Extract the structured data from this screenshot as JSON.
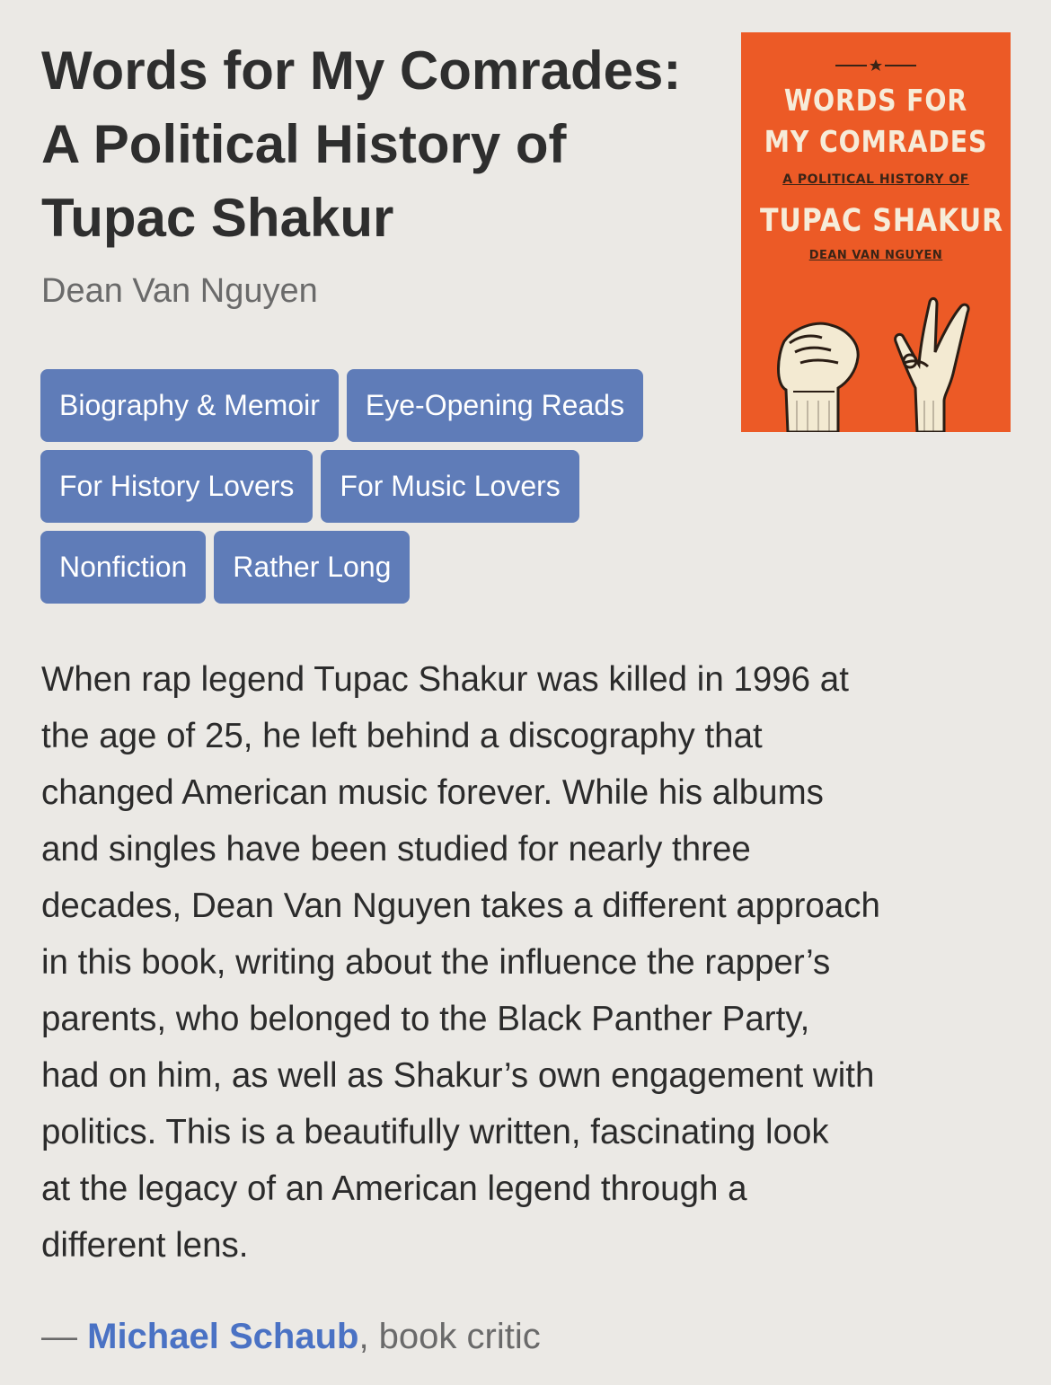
{
  "book": {
    "title_lines": [
      "Words for My Comrades:",
      "A Political History of",
      "Tupac Shakur"
    ],
    "author": "Dean Van Nguyen"
  },
  "tags": [
    "Biography & Memoir",
    "Eye-Opening Reads",
    "For History Lovers",
    "For Music Lovers",
    "Nonfiction",
    "Rather Long"
  ],
  "cover": {
    "line1": "WORDS FOR",
    "line2": "MY COMRADES",
    "subtitle": "A POLITICAL HISTORY OF",
    "name": "TUPAC SHAKUR",
    "author": "DEAN VAN NGUYEN",
    "background_color": "#ec5a26",
    "icons": [
      "star-icon",
      "raised-fist-icon",
      "peace-sign-hand-icon"
    ]
  },
  "description_lines": [
    "When rap legend Tupac Shakur was killed in 1996 at",
    "the age of 25, he left behind a discography that",
    "changed American music forever. While his albums",
    "and singles have been studied for nearly three",
    "decades, Dean Van Nguyen takes a different approach",
    "in this book, writing about the influence the rapper’s",
    "parents, who belonged to the Black Panther Party,",
    "had on him, as well as Shakur’s own engagement with",
    "politics. This is a beautifully written, fascinating look",
    "at the legacy of an American legend through a",
    "different lens."
  ],
  "attribution": {
    "dash": "—",
    "critic_name": "Michael Schaub",
    "critic_role": ", book critic"
  },
  "colors": {
    "background": "#ebe9e5",
    "tag_background": "#5f7cb8",
    "link": "#4a72c4"
  }
}
